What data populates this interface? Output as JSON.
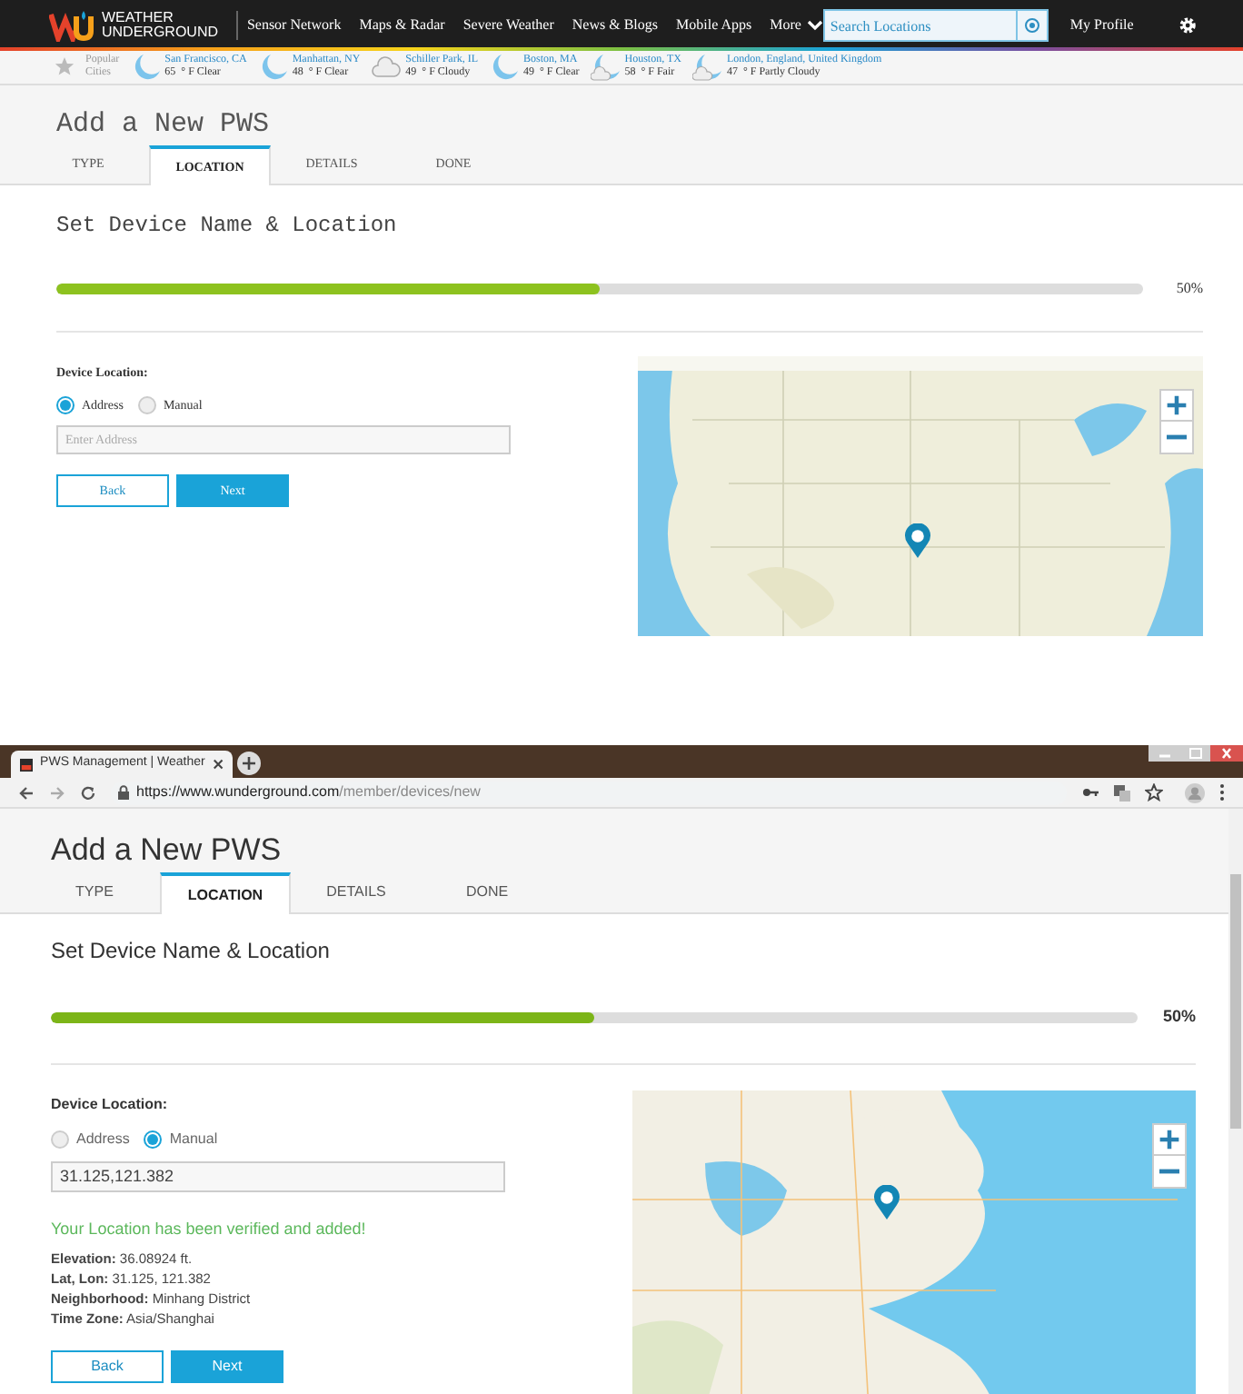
{
  "site_header": {
    "logo": [
      "WEATHER",
      "UNDERGROUND"
    ],
    "nav": [
      "Sensor Network",
      "Maps & Radar",
      "Severe Weather",
      "News & Blogs",
      "Mobile Apps",
      "More"
    ],
    "search": {
      "placeholder": "Search Locations"
    },
    "profile": "My Profile"
  },
  "popular_cities": {
    "label": [
      "Popular",
      "Cities"
    ],
    "cities": [
      {
        "name": "San Francisco, CA",
        "reading": "65  ° F Clear",
        "kind": "moon"
      },
      {
        "name": "Manhattan, NY",
        "reading": "48  ° F Clear",
        "kind": "moon"
      },
      {
        "name": "Schiller Park, IL",
        "reading": "49  ° F Cloudy",
        "kind": "cloud"
      },
      {
        "name": "Boston, MA",
        "reading": "49  ° F Clear",
        "kind": "moon"
      },
      {
        "name": "Houston, TX",
        "reading": "58  ° F Fair",
        "kind": "moon-cloud"
      },
      {
        "name": "London, England, United Kingdom",
        "reading": "47  ° F Partly Cloudy",
        "kind": "moon-cloud"
      }
    ]
  },
  "top_form": {
    "title": "Add a New PWS",
    "tabs": [
      {
        "label": "TYPE",
        "selected": false
      },
      {
        "label": "LOCATION",
        "selected": true
      },
      {
        "label": "DETAILS",
        "selected": false
      },
      {
        "label": "DONE",
        "selected": false
      }
    ],
    "section_title": "Set Device Name & Location",
    "progress": {
      "level": 0.5,
      "label": "50%"
    },
    "location_label": "Device Location:",
    "options": [
      {
        "label": "Address",
        "selected": true
      },
      {
        "label": "Manual",
        "selected": false
      }
    ],
    "input": {
      "placeholder": "Enter Address"
    },
    "buttons": [
      {
        "label": "Back",
        "kind": "secondary"
      },
      {
        "label": "Next",
        "kind": "primary"
      }
    ]
  },
  "browser": {
    "tab_title": "PWS Management | Weather",
    "url": {
      "domain": "https://www.wunderground.com",
      "path": "/member/devices/new"
    }
  },
  "bottom_form": {
    "title": "Add a New PWS",
    "tabs": [
      {
        "label": "TYPE",
        "selected": false
      },
      {
        "label": "LOCATION",
        "selected": true
      },
      {
        "label": "DETAILS",
        "selected": false
      },
      {
        "label": "DONE",
        "selected": false
      }
    ],
    "section_title": "Set Device Name & Location",
    "progress": {
      "level": 0.5,
      "label": "50%"
    },
    "location_label": "Device Location:",
    "options": [
      {
        "label": "Address",
        "selected": false
      },
      {
        "label": "Manual",
        "selected": true
      }
    ],
    "input": {
      "value": "31.125,121.382"
    },
    "verified": "Your Location has been verified and added!",
    "details": [
      "**Elevation:** 36.08924 ft.",
      "**Lat, Lon:** 31.125, 121.382",
      "**Neighborhood:** Minhang District",
      "**Time Zone:** Asia/Shanghai"
    ],
    "buttons": [
      {
        "label": "Back",
        "kind": "secondary"
      },
      {
        "label": "Next",
        "kind": "primary"
      }
    ]
  }
}
